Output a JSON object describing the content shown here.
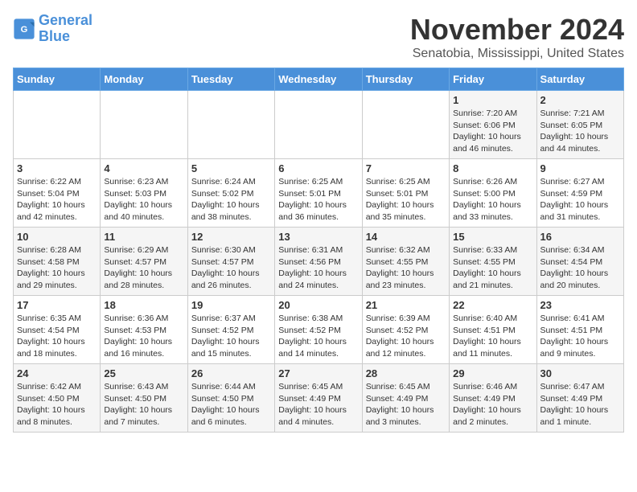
{
  "header": {
    "logo_line1": "General",
    "logo_line2": "Blue",
    "month_title": "November 2024",
    "location": "Senatobia, Mississippi, United States"
  },
  "days_of_week": [
    "Sunday",
    "Monday",
    "Tuesday",
    "Wednesday",
    "Thursday",
    "Friday",
    "Saturday"
  ],
  "weeks": [
    [
      {
        "day": "",
        "info": ""
      },
      {
        "day": "",
        "info": ""
      },
      {
        "day": "",
        "info": ""
      },
      {
        "day": "",
        "info": ""
      },
      {
        "day": "",
        "info": ""
      },
      {
        "day": "1",
        "info": "Sunrise: 7:20 AM\nSunset: 6:06 PM\nDaylight: 10 hours\nand 46 minutes."
      },
      {
        "day": "2",
        "info": "Sunrise: 7:21 AM\nSunset: 6:05 PM\nDaylight: 10 hours\nand 44 minutes."
      }
    ],
    [
      {
        "day": "3",
        "info": "Sunrise: 6:22 AM\nSunset: 5:04 PM\nDaylight: 10 hours\nand 42 minutes."
      },
      {
        "day": "4",
        "info": "Sunrise: 6:23 AM\nSunset: 5:03 PM\nDaylight: 10 hours\nand 40 minutes."
      },
      {
        "day": "5",
        "info": "Sunrise: 6:24 AM\nSunset: 5:02 PM\nDaylight: 10 hours\nand 38 minutes."
      },
      {
        "day": "6",
        "info": "Sunrise: 6:25 AM\nSunset: 5:01 PM\nDaylight: 10 hours\nand 36 minutes."
      },
      {
        "day": "7",
        "info": "Sunrise: 6:25 AM\nSunset: 5:01 PM\nDaylight: 10 hours\nand 35 minutes."
      },
      {
        "day": "8",
        "info": "Sunrise: 6:26 AM\nSunset: 5:00 PM\nDaylight: 10 hours\nand 33 minutes."
      },
      {
        "day": "9",
        "info": "Sunrise: 6:27 AM\nSunset: 4:59 PM\nDaylight: 10 hours\nand 31 minutes."
      }
    ],
    [
      {
        "day": "10",
        "info": "Sunrise: 6:28 AM\nSunset: 4:58 PM\nDaylight: 10 hours\nand 29 minutes."
      },
      {
        "day": "11",
        "info": "Sunrise: 6:29 AM\nSunset: 4:57 PM\nDaylight: 10 hours\nand 28 minutes."
      },
      {
        "day": "12",
        "info": "Sunrise: 6:30 AM\nSunset: 4:57 PM\nDaylight: 10 hours\nand 26 minutes."
      },
      {
        "day": "13",
        "info": "Sunrise: 6:31 AM\nSunset: 4:56 PM\nDaylight: 10 hours\nand 24 minutes."
      },
      {
        "day": "14",
        "info": "Sunrise: 6:32 AM\nSunset: 4:55 PM\nDaylight: 10 hours\nand 23 minutes."
      },
      {
        "day": "15",
        "info": "Sunrise: 6:33 AM\nSunset: 4:55 PM\nDaylight: 10 hours\nand 21 minutes."
      },
      {
        "day": "16",
        "info": "Sunrise: 6:34 AM\nSunset: 4:54 PM\nDaylight: 10 hours\nand 20 minutes."
      }
    ],
    [
      {
        "day": "17",
        "info": "Sunrise: 6:35 AM\nSunset: 4:54 PM\nDaylight: 10 hours\nand 18 minutes."
      },
      {
        "day": "18",
        "info": "Sunrise: 6:36 AM\nSunset: 4:53 PM\nDaylight: 10 hours\nand 16 minutes."
      },
      {
        "day": "19",
        "info": "Sunrise: 6:37 AM\nSunset: 4:52 PM\nDaylight: 10 hours\nand 15 minutes."
      },
      {
        "day": "20",
        "info": "Sunrise: 6:38 AM\nSunset: 4:52 PM\nDaylight: 10 hours\nand 14 minutes."
      },
      {
        "day": "21",
        "info": "Sunrise: 6:39 AM\nSunset: 4:52 PM\nDaylight: 10 hours\nand 12 minutes."
      },
      {
        "day": "22",
        "info": "Sunrise: 6:40 AM\nSunset: 4:51 PM\nDaylight: 10 hours\nand 11 minutes."
      },
      {
        "day": "23",
        "info": "Sunrise: 6:41 AM\nSunset: 4:51 PM\nDaylight: 10 hours\nand 9 minutes."
      }
    ],
    [
      {
        "day": "24",
        "info": "Sunrise: 6:42 AM\nSunset: 4:50 PM\nDaylight: 10 hours\nand 8 minutes."
      },
      {
        "day": "25",
        "info": "Sunrise: 6:43 AM\nSunset: 4:50 PM\nDaylight: 10 hours\nand 7 minutes."
      },
      {
        "day": "26",
        "info": "Sunrise: 6:44 AM\nSunset: 4:50 PM\nDaylight: 10 hours\nand 6 minutes."
      },
      {
        "day": "27",
        "info": "Sunrise: 6:45 AM\nSunset: 4:49 PM\nDaylight: 10 hours\nand 4 minutes."
      },
      {
        "day": "28",
        "info": "Sunrise: 6:45 AM\nSunset: 4:49 PM\nDaylight: 10 hours\nand 3 minutes."
      },
      {
        "day": "29",
        "info": "Sunrise: 6:46 AM\nSunset: 4:49 PM\nDaylight: 10 hours\nand 2 minutes."
      },
      {
        "day": "30",
        "info": "Sunrise: 6:47 AM\nSunset: 4:49 PM\nDaylight: 10 hours\nand 1 minute."
      }
    ]
  ]
}
